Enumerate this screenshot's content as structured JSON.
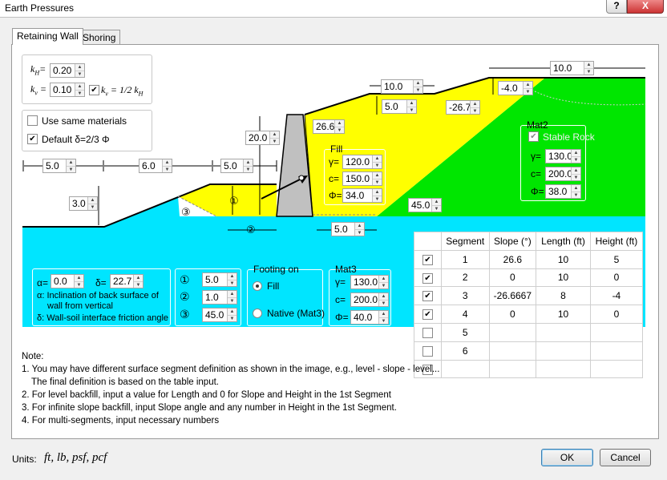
{
  "window": {
    "title": "Earth Pressures",
    "help_label": "?",
    "close_label": "X"
  },
  "tabs": [
    {
      "label": "Retaining Wall",
      "active": true
    },
    {
      "label": "Shoring",
      "active": false
    }
  ],
  "coeffs": {
    "kh_label": "k",
    "kh_sub": "H",
    "kh_value": "0.20",
    "kv_label": "k",
    "kv_sub": "v",
    "kv_value": "0.10",
    "kv_formula": "k",
    "kv_formula_rest": " = 1/2 k",
    "kv_formula_sub": "H",
    "kv_check": true
  },
  "options": {
    "same_materials_label": "Use same materials",
    "same_materials": false,
    "default_delta_label": "Default δ=2/3 Φ",
    "default_delta": true
  },
  "dims": {
    "top_len": "10.0",
    "seg1_len": "10.0",
    "seg1_h": "5.0",
    "seg3_h": "-4.0",
    "seg3_slope": "-26.7",
    "seg1_slope": "26.6",
    "wall_h": "20.0",
    "left_a": "5.0",
    "left_b": "6.0",
    "left_c": "5.0",
    "toe_h": "3.0",
    "heel": "5.0",
    "backfill_angle": "45.0"
  },
  "fill": {
    "title": "Fill",
    "gamma_label": "γ=",
    "gamma": "120.0",
    "c_label": "c=",
    "c": "150.0",
    "phi_label": "Φ=",
    "phi": "34.0"
  },
  "mat2": {
    "title": "Mat2",
    "stable_rock_label": "Stable Rock",
    "gamma_label": "γ=",
    "gamma": "130.0",
    "c_label": "c=",
    "c": "200.0",
    "phi_label": "Φ=",
    "phi": "38.0"
  },
  "mat3": {
    "title": "Mat3",
    "gamma_label": "γ=",
    "gamma": "130.0",
    "c_label": "c=",
    "c": "200.0",
    "phi_label": "Φ=",
    "phi": "40.0"
  },
  "alpha_delta": {
    "alpha_label": "α=",
    "alpha": "0.0",
    "delta_label": "δ=",
    "delta": "22.7",
    "note_alpha": "α: Inclination of back surface of",
    "note_alpha2": "wall from vertical",
    "note_delta": "δ: Wall-soil interface friction angle"
  },
  "circled": {
    "one_label": "①",
    "one": "5.0",
    "two_label": "②",
    "two": "1.0",
    "three_label": "③",
    "three": "45.0"
  },
  "footing": {
    "title": "Footing on",
    "fill_label": "Fill",
    "native_label": "Native (Mat3)",
    "selected": "Fill"
  },
  "table": {
    "headers": [
      "",
      "Segment",
      "Slope (°)",
      "Length (ft)",
      "Height (ft)"
    ],
    "rows": [
      {
        "checked": true,
        "segment": "1",
        "slope": "26.6",
        "length": "10",
        "height": "5"
      },
      {
        "checked": true,
        "segment": "2",
        "slope": "0",
        "length": "10",
        "height": "0"
      },
      {
        "checked": true,
        "segment": "3",
        "slope": "-26.6667",
        "length": "8",
        "height": "-4"
      },
      {
        "checked": true,
        "segment": "4",
        "slope": "0",
        "length": "10",
        "height": "0"
      },
      {
        "checked": false,
        "segment": "5",
        "slope": "",
        "length": "",
        "height": ""
      },
      {
        "checked": false,
        "segment": "6",
        "slope": "",
        "length": "",
        "height": ""
      },
      {
        "checked": false,
        "segment": "",
        "slope": "",
        "length": "",
        "height": ""
      }
    ]
  },
  "notes": [
    "Note:",
    "1. You may have different surface segment definition as shown in the image, e.g., level - slope - level...",
    "    The final definition is based on the table input.",
    "2. For level backfill, input a value for Length and 0 for Slope and Height in the 1st Segment",
    "3. For infinite slope backfill, input Slope angle and any number in Height in the 1st Segment.",
    "4. For multi-segments, input necessary numbers"
  ],
  "units": {
    "label": "Units:",
    "value": "ft, lb, psf, pcf"
  },
  "buttons": {
    "ok": "OK",
    "cancel": "Cancel"
  },
  "colors": {
    "fill": "#ffff00",
    "rock": "#00e600",
    "native": "#00e5ff",
    "wall": "#c0c0c0"
  }
}
